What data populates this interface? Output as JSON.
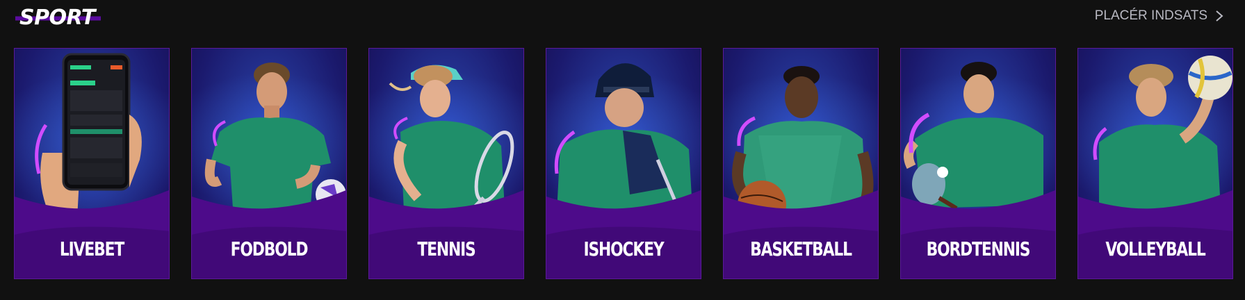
{
  "header": {
    "title": "SPORT",
    "cta_label": "PLACÉR INDSATS"
  },
  "cards": [
    {
      "label": "LIVEBET",
      "icon": "phone-app-icon"
    },
    {
      "label": "FODBOLD",
      "icon": "football-player-icon"
    },
    {
      "label": "TENNIS",
      "icon": "tennis-player-icon"
    },
    {
      "label": "ISHOCKEY",
      "icon": "hockey-player-icon"
    },
    {
      "label": "BASKETBALL",
      "icon": "basketball-player-icon"
    },
    {
      "label": "BORDTENNIS",
      "icon": "table-tennis-player-icon"
    },
    {
      "label": "VOLLEYBALL",
      "icon": "volleyball-player-icon"
    }
  ],
  "colors": {
    "background": "#111111",
    "card_blue": "#23318f",
    "card_purple": "#4d0b8a",
    "jersey_green": "#1f8f6a",
    "accent_green": "#2bd18a",
    "accent_pink": "#d14cff"
  }
}
